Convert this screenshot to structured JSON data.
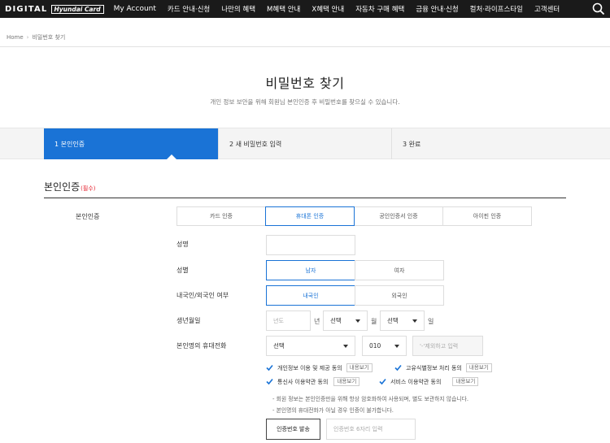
{
  "topnav": {
    "logo_digital": "DIGITAL",
    "logo_hc": "Hyundai Card",
    "items": [
      "My Account",
      "카드 안내·신청",
      "나만의 혜택",
      "M혜택 안내",
      "X혜택 안내",
      "자동차 구매 혜택",
      "금융 안내·신청",
      "컬처·라이프스타일",
      "고객센터"
    ]
  },
  "breadcrumb": {
    "home": "Home",
    "sep": "›",
    "current": "비밀번호 찾기"
  },
  "title": "비밀번호 찾기",
  "description": "개인 정보 보안을 위해 회원님 본인인증 후 비밀번호를 찾으실 수 있습니다.",
  "steps": [
    "1 본인인증",
    "2 새 비밀번호 입력",
    "3 완료"
  ],
  "section": {
    "title": "본인인증",
    "required": "(필수)"
  },
  "labels": {
    "auth": "본인인증",
    "name": "성명",
    "gender": "성별",
    "nationality": "내국인/외국인 여부",
    "birth": "생년월일",
    "phone": "본인명의 휴대전화"
  },
  "auth_tabs": [
    "카드 인증",
    "휴대폰 인증",
    "공인인증서 인증",
    "아이핀 인증"
  ],
  "gender": [
    "남자",
    "여자"
  ],
  "nationality": [
    "내국인",
    "외국인"
  ],
  "birth": {
    "year_placeholder": "년도",
    "year_unit": "년",
    "month_value": "선택",
    "month_unit": "월",
    "day_value": "선택",
    "day_unit": "일"
  },
  "phone": {
    "carrier_value": "선택",
    "prefix_value": "010",
    "number_placeholder": "'-'제외하고 입력"
  },
  "agreements": [
    {
      "label": "개인정보 이용 및 제공 동의",
      "view": "내용보기"
    },
    {
      "label": "고유식별정보 처리 동의",
      "view": "내용보기"
    },
    {
      "label": "통신사 이용약관 동의",
      "view": "내용보기"
    },
    {
      "label": "서비스 이용약관 동의",
      "view": "내용보기"
    }
  ],
  "notes": [
    "- 회원 정보는 본인인증만을 위해 항상 암호화하여 사용되며, 별도 보관하지 않습니다.",
    "- 본인명의 휴대전화가 아닐 경우 인증이 불가합니다."
  ],
  "send_button": "인증번호 발송",
  "code_placeholder": "인증번호 6자리 입력",
  "colors": {
    "accent": "#1a73d6",
    "required": "#e5212e",
    "nav_bg": "#1a1a1a"
  }
}
